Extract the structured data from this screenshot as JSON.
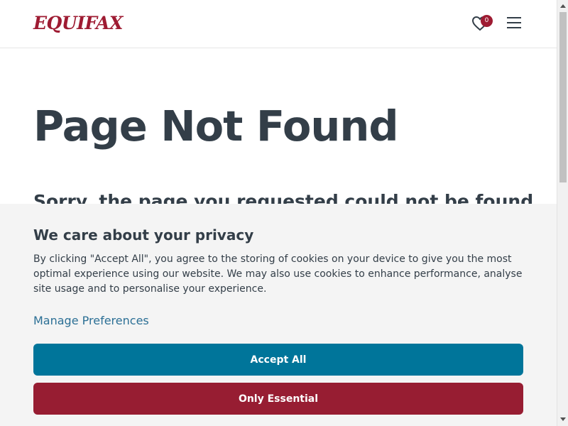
{
  "header": {
    "logo_text": "EQUIFAX",
    "saved_count": "0"
  },
  "main": {
    "title": "Page Not Found",
    "subtitle": "Sorry, the page you requested could not be found"
  },
  "cookie_banner": {
    "title": "We care about your privacy",
    "body": "By clicking \"Accept All\", you agree to the storing of cookies on your device to give you the most optimal experience using our website. We may also use cookies to enhance performance, analyse site usage and to personalise your experience.",
    "manage_link": "Manage Preferences",
    "accept_label": "Accept All",
    "essential_label": "Only Essential"
  },
  "icons": {
    "saved": "heart-icon",
    "menu": "hamburger-menu-icon"
  },
  "colors": {
    "brand": "#9e1b32",
    "accept": "#00759a",
    "essential": "#971d32",
    "link": "#2b6f95",
    "text": "#333e48"
  }
}
